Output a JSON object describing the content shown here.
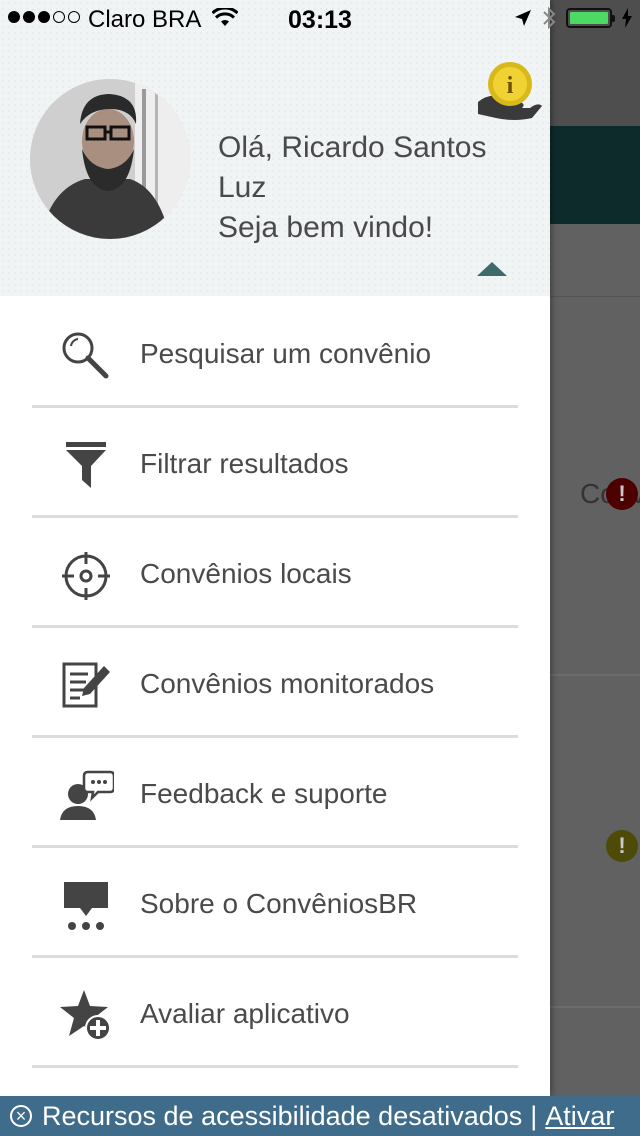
{
  "status_bar": {
    "carrier": "Claro BRA",
    "time": "03:13"
  },
  "profile": {
    "greeting_line1": "Olá, Ricardo Santos Luz",
    "greeting_line2": "Seja bem vindo!"
  },
  "menu": {
    "items": [
      {
        "label": "Pesquisar um convênio",
        "icon": "search-icon"
      },
      {
        "label": "Filtrar resultados",
        "icon": "filter-icon"
      },
      {
        "label": "Convênios locais",
        "icon": "location-target-icon"
      },
      {
        "label": "Convênios monitorados",
        "icon": "edit-document-icon"
      },
      {
        "label": "Feedback e suporte",
        "icon": "support-chat-icon"
      },
      {
        "label": "Sobre o ConvêniosBR",
        "icon": "about-icon"
      },
      {
        "label": "Avaliar aplicativo",
        "icon": "rate-star-icon"
      }
    ]
  },
  "background_app": {
    "tab_label": "Conv"
  },
  "accessibility_bar": {
    "message": "Recursos de acessibilidade desativados",
    "separator": "|",
    "action": "Ativar"
  },
  "colors": {
    "accent": "#3f6a6a",
    "banner": "#3f6c8a",
    "alert_red": "#4d0000",
    "alert_olive": "#4e4a07"
  }
}
